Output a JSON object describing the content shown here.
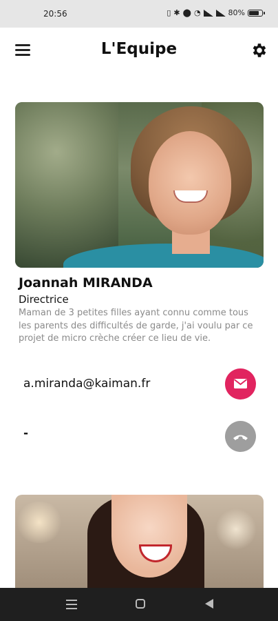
{
  "status_bar": {
    "time": "20:56",
    "battery": "80%",
    "battery_level": 0.8
  },
  "app_bar": {
    "title": "L'Equipe",
    "menu_icon": "hamburger-menu-icon",
    "settings_icon": "gear-icon"
  },
  "members": [
    {
      "name": "Joannah MIRANDA",
      "role": "Directrice",
      "bio": "Maman de 3 petites filles ayant connu comme tous les parents des difficultés de garde, j'ai voulu par ce projet de micro crèche créer ce lieu de vie.",
      "email": "a.miranda@kaiman.fr",
      "phone": "-",
      "email_button_color": "#e1245f",
      "phone_button_color": "#9e9e9e"
    }
  ],
  "nav_bar": {
    "icons": [
      "recent-apps-icon",
      "home-icon",
      "back-icon"
    ]
  }
}
